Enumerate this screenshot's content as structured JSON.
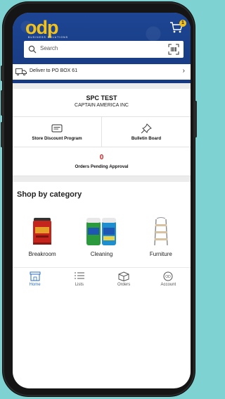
{
  "header": {
    "logo": "odp",
    "logo_tagline": "BUSINESS SOLUTIONS",
    "cart_badge": "1"
  },
  "search": {
    "placeholder": "Search"
  },
  "delivery": {
    "label": "Deliver to PO BOX 61"
  },
  "account": {
    "name": "SPC TEST",
    "company": "CAPTAIN AMERICA INC"
  },
  "quick_links": [
    {
      "label": "Store Discount Program",
      "icon": "card-icon"
    },
    {
      "label": "Bulletin Board",
      "icon": "pin-icon"
    }
  ],
  "pending": {
    "count": "0",
    "label": "Orders Pending Approval"
  },
  "shop": {
    "title": "Shop by category",
    "categories": [
      {
        "label": "Breakroom",
        "icon": "coffee-can-image"
      },
      {
        "label": "Cleaning",
        "icon": "wipes-image"
      },
      {
        "label": "Furniture",
        "icon": "shelf-image"
      }
    ]
  },
  "tabs": [
    {
      "label": "Home",
      "icon": "home-icon",
      "active": true
    },
    {
      "label": "Lists",
      "icon": "list-icon"
    },
    {
      "label": "Orders",
      "icon": "box-icon"
    },
    {
      "label": "Account",
      "icon": "account-icon"
    }
  ],
  "colors": {
    "brand_blue": "#1a3f8a",
    "brand_yellow": "#f3c21a",
    "alert_red": "#d42020",
    "active_tab": "#2d6ec6",
    "background": "#7fd2d2"
  }
}
